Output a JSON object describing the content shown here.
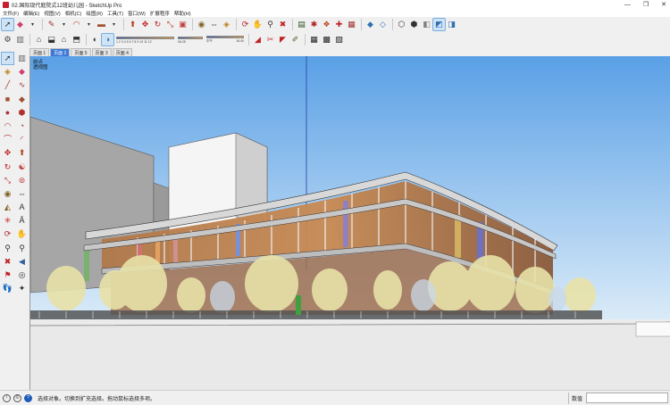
{
  "window": {
    "title": "02.国际现代庭院式12班幼儿园 - SketchUp Pro",
    "controls": {
      "minimize": "—",
      "restore": "❐",
      "close": "✕"
    }
  },
  "menu": [
    "文件(F)",
    "编辑(E)",
    "视图(V)",
    "相机(C)",
    "绘图(R)",
    "工具(T)",
    "窗口(W)",
    "扩展程序",
    "帮助(H)"
  ],
  "toolbar": {
    "row1_icons": [
      "select-arrow",
      "eraser",
      "pencil-line",
      "freehand",
      "arc",
      "rectangle",
      "push-pull",
      "move",
      "rotate",
      "scale",
      "offset",
      "tape-measure",
      "dimension",
      "paint-bucket",
      "orbit",
      "pan",
      "zoom",
      "zoom-extents",
      "warehouse",
      "extension-warehouse",
      "components",
      "materials",
      "layers",
      "styles",
      "xray",
      "wireframe",
      "hidden-line",
      "shaded",
      "textured",
      "monochrome"
    ],
    "row2_icons": [
      "extension-a",
      "extension-b",
      "home-view",
      "iso-view",
      "top-view",
      "front-view",
      "right-view",
      "shadows",
      "fog"
    ],
    "shadow_months": "1 2 3 4 5 6 7 8 9 10 11 12",
    "shadow_time_start": "06:28",
    "shadow_time_noon": "中午",
    "shadow_time_end": "16:40",
    "row2_extra_icons": [
      "section-plane",
      "section-display",
      "section-cut",
      "sandbox",
      "grid-a",
      "grid-b",
      "grid-c"
    ]
  },
  "scene_tabs": [
    "页面 1",
    "页面 2",
    "页面 5",
    "页面 3",
    "页面 4"
  ],
  "active_scene": 1,
  "viewport": {
    "label_line1": "前点",
    "label_line2": "透视图"
  },
  "left_tools": [
    "select",
    "component",
    "paint",
    "eraser",
    "line",
    "freehand",
    "rectangle",
    "rotated-rect",
    "circle",
    "polygon",
    "arc",
    "pie",
    "move",
    "push-pull",
    "rotate",
    "follow-me",
    "scale",
    "offset",
    "tape",
    "dimension",
    "protractor",
    "text",
    "axes",
    "3d-text",
    "orbit",
    "pan",
    "zoom",
    "zoom-window",
    "zoom-extents",
    "previous",
    "position-camera",
    "look-around",
    "walk",
    "section"
  ],
  "status": {
    "message": "选择对象。切换到扩充选择。拖动鼠标选择多项。",
    "measurements_label": "数值"
  },
  "colors": {
    "sky_top": "#5aa0e6",
    "sky_bottom": "#dcecf8",
    "ground": "#ebebeb",
    "active_tab": "#3c78d8",
    "selected_tool": "#cfe3f7"
  }
}
